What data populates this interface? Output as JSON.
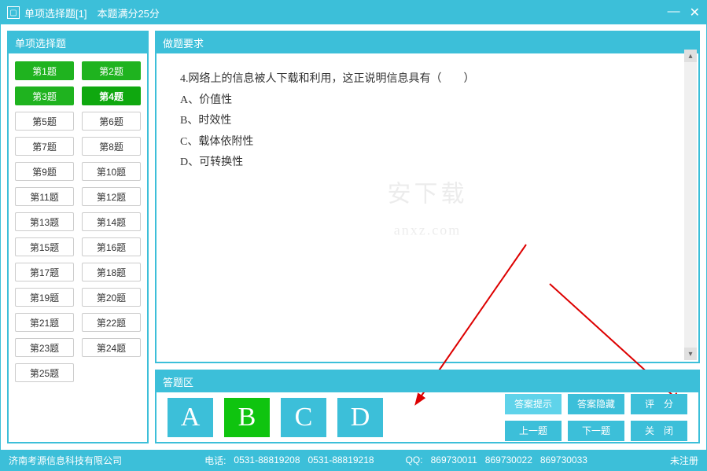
{
  "titlebar": {
    "title": "单项选择题[1]　本题满分25分"
  },
  "sidebar": {
    "header": "单项选择题",
    "questions": [
      {
        "label": "第1题",
        "state": "answered"
      },
      {
        "label": "第2题",
        "state": "answered"
      },
      {
        "label": "第3题",
        "state": "answered"
      },
      {
        "label": "第4题",
        "state": "current"
      },
      {
        "label": "第5题",
        "state": ""
      },
      {
        "label": "第6题",
        "state": ""
      },
      {
        "label": "第7题",
        "state": ""
      },
      {
        "label": "第8题",
        "state": ""
      },
      {
        "label": "第9题",
        "state": ""
      },
      {
        "label": "第10题",
        "state": ""
      },
      {
        "label": "第11题",
        "state": ""
      },
      {
        "label": "第12题",
        "state": ""
      },
      {
        "label": "第13题",
        "state": ""
      },
      {
        "label": "第14题",
        "state": ""
      },
      {
        "label": "第15题",
        "state": ""
      },
      {
        "label": "第16题",
        "state": ""
      },
      {
        "label": "第17题",
        "state": ""
      },
      {
        "label": "第18题",
        "state": ""
      },
      {
        "label": "第19题",
        "state": ""
      },
      {
        "label": "第20题",
        "state": ""
      },
      {
        "label": "第21题",
        "state": ""
      },
      {
        "label": "第22题",
        "state": ""
      },
      {
        "label": "第23题",
        "state": ""
      },
      {
        "label": "第24题",
        "state": ""
      },
      {
        "label": "第25题",
        "state": ""
      }
    ]
  },
  "question_panel": {
    "header": "做题要求",
    "stem": "4.网络上的信息被人下载和利用，这正说明信息具有（　　）",
    "options": {
      "A": "A、价值性",
      "B": "B、时效性",
      "C": "C、载体依附性",
      "D": "D、可转换性"
    }
  },
  "answer_panel": {
    "header": "答题区",
    "choices": [
      "A",
      "B",
      "C",
      "D"
    ],
    "selected": "B",
    "actions": {
      "show_answer": "答案提示",
      "hide_answer": "答案隐藏",
      "score": "评　分",
      "prev": "上一题",
      "next": "下一题",
      "close": "关　闭"
    }
  },
  "statusbar": {
    "company": "济南考源信息科技有限公司",
    "phone_label": "电话:",
    "phone1": "0531-88819208",
    "phone2": "0531-88819218",
    "qq_label": "QQ:",
    "qq1": "869730011",
    "qq2": "869730022",
    "qq3": "869730033",
    "register": "未注册"
  },
  "watermark": {
    "top": "安下载",
    "bottom": "anxz.com"
  }
}
